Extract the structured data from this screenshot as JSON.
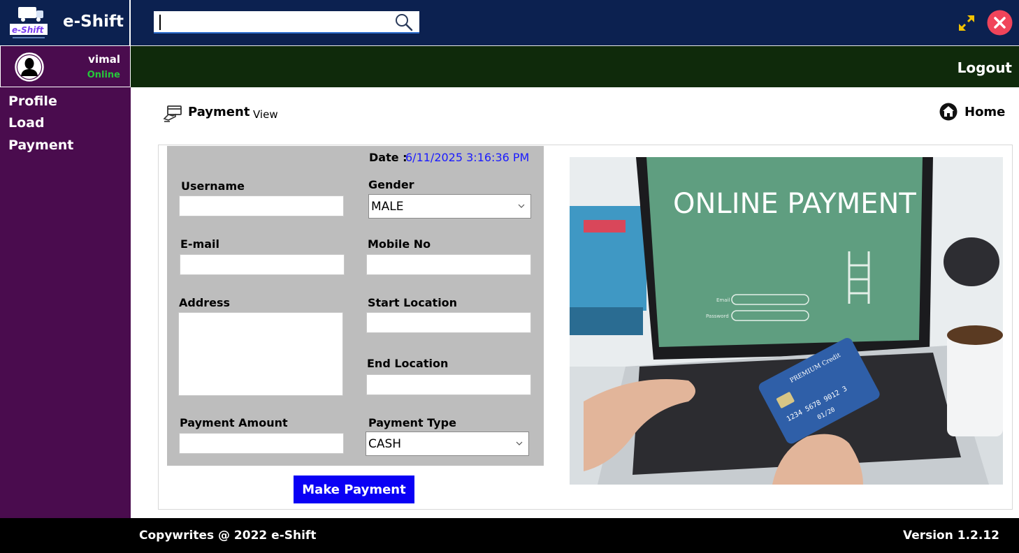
{
  "app": {
    "name": "e-Shift",
    "logo_text": "e-Shift"
  },
  "search": {
    "value": "",
    "placeholder": ""
  },
  "user": {
    "name": "vimal",
    "status": "Online",
    "logout_label": "Logout"
  },
  "sidebar": {
    "items": [
      {
        "label": "Profile"
      },
      {
        "label": "Load"
      },
      {
        "label": "Payment"
      }
    ]
  },
  "page": {
    "title": "Payment",
    "subtitle": "View",
    "home_label": "Home"
  },
  "form": {
    "date_label": "Date :",
    "date_value": "6/11/2025 3:16:36 PM",
    "username_label": "Username",
    "username_value": "",
    "gender_label": "Gender",
    "gender_value": "MALE",
    "email_label": "E-mail",
    "email_value": "",
    "mobile_label": "Mobile No",
    "mobile_value": "",
    "address_label": "Address",
    "address_value": "",
    "start_location_label": "Start Location",
    "start_location_value": "",
    "end_location_label": "End Location",
    "end_location_value": "",
    "payment_amount_label": "Payment Amount",
    "payment_amount_value": "",
    "payment_type_label": "Payment Type",
    "payment_type_value": "CASH",
    "submit_label": "Make Payment"
  },
  "illustration": {
    "screen_text": "ONLINE PAYMENT",
    "email_label": "Email",
    "password_label": "Password",
    "card_text": "PREMIUM Credit",
    "card_number": "1234 5678 9012 3",
    "card_expiry": "01/20"
  },
  "footer": {
    "copyright": "Copywrites  @  2022  e-Shift",
    "version": "Version  1.2.12"
  },
  "colors": {
    "topbar": "#0c2150",
    "sidebar": "#4a0c4e",
    "userbar": "#0f2a0b",
    "button": "#0a00f5",
    "date_value": "#1a1aff",
    "status_online": "#26c63a"
  }
}
